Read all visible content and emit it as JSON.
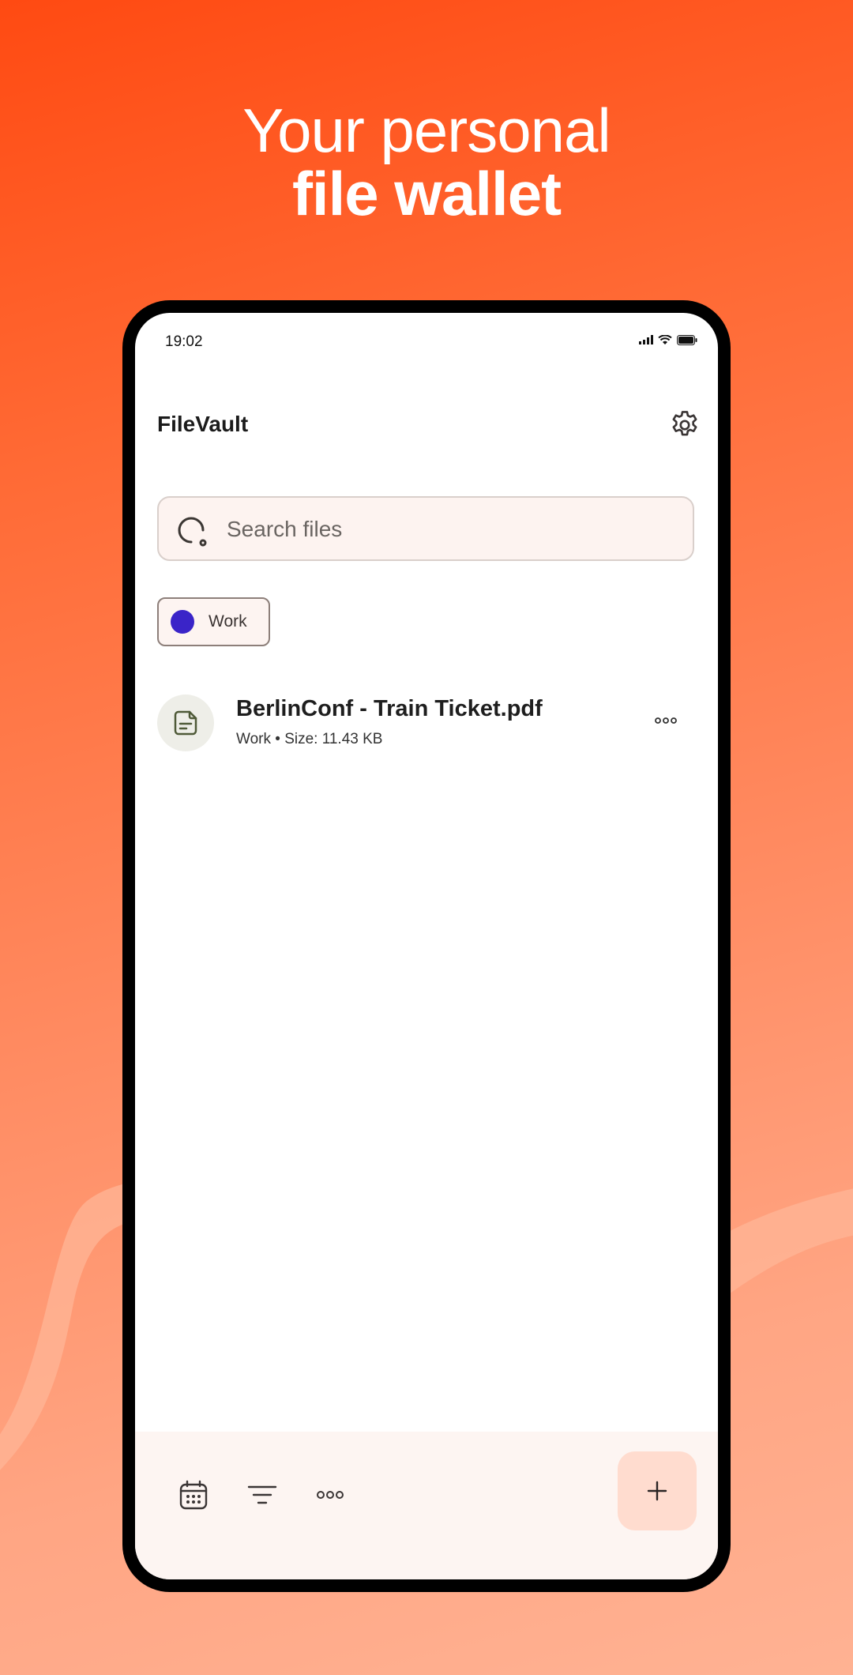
{
  "headline": {
    "line1": "Your personal",
    "line2": "file wallet"
  },
  "status_bar": {
    "time": "19:02"
  },
  "app": {
    "title": "FileVault"
  },
  "search": {
    "placeholder": "Search files",
    "value": ""
  },
  "filters": [
    {
      "label": "Work",
      "color": "#3a24c8"
    }
  ],
  "files": [
    {
      "name": "BerlinConf - Train Ticket.pdf",
      "meta": "Work • Size: 11.43 KB"
    }
  ],
  "colors": {
    "accent": "#ff4a12",
    "tag_work": "#3a24c8",
    "fab_bg": "#ffdccf"
  },
  "icons": {
    "settings": "gear-icon",
    "search": "search-icon",
    "file": "file-icon",
    "more": "more-icon",
    "calendar": "calendar-icon",
    "filter": "filter-icon",
    "add": "plus-icon"
  }
}
